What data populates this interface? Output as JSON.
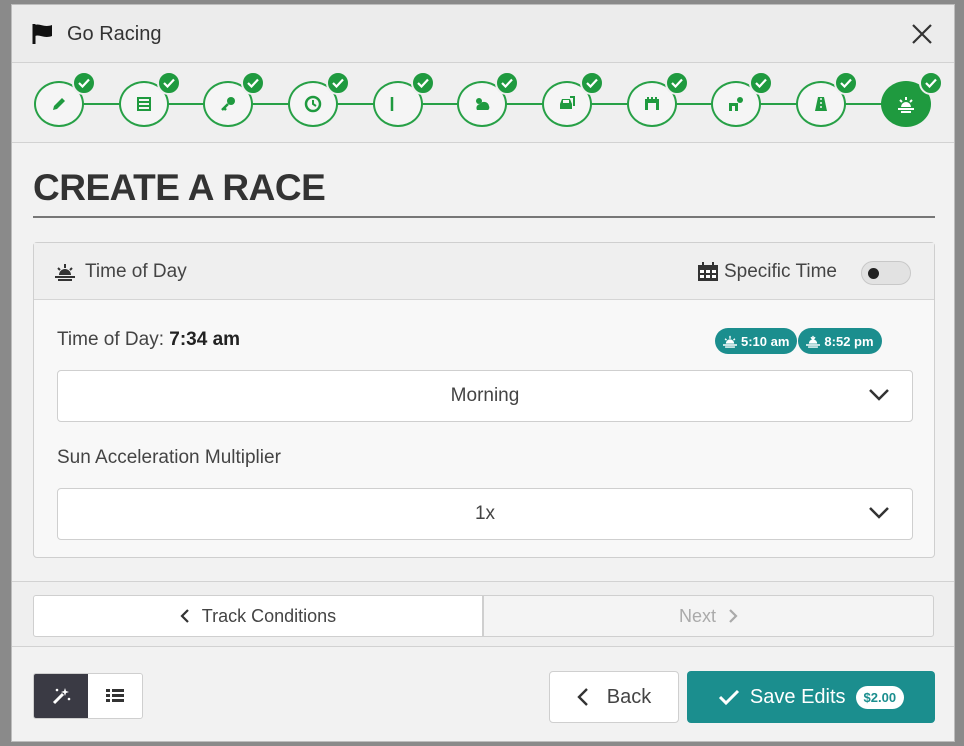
{
  "window": {
    "title": "Go Racing",
    "icons": {
      "flag": "flag-icon",
      "close": "close-icon"
    }
  },
  "stepper": {
    "steps": [
      {
        "icon": "pencil-icon",
        "completed": true
      },
      {
        "icon": "list-icon",
        "completed": true
      },
      {
        "icon": "key-icon",
        "completed": true
      },
      {
        "icon": "clock-icon",
        "completed": true
      },
      {
        "icon": "flag-icon",
        "completed": true
      },
      {
        "icon": "weather-icon",
        "completed": true
      },
      {
        "icon": "car-icon",
        "completed": true
      },
      {
        "icon": "garage-icon",
        "completed": true
      },
      {
        "icon": "pit-icon",
        "completed": true
      },
      {
        "icon": "track-icon",
        "completed": true
      },
      {
        "icon": "sunrise-icon",
        "completed": true,
        "active": true
      }
    ]
  },
  "page": {
    "heading": "CREATE A RACE"
  },
  "panel": {
    "title": "Time of Day",
    "specific_time_label": "Specific Time",
    "specific_time_on": false,
    "time_of_day_label": "Time of Day: ",
    "time_of_day_value": "7:34 am",
    "sunrise": "5:10 am",
    "sunset": "8:52 pm",
    "time_select": "Morning",
    "sun_accel_label": "Sun Acceleration Multiplier",
    "sun_accel_select": "1x"
  },
  "nav": {
    "prev": "Track Conditions",
    "next": "Next"
  },
  "footer": {
    "back": "Back",
    "save": "Save Edits",
    "price": "$2.00"
  },
  "colors": {
    "green": "#1f9a3f",
    "teal": "#1b8e8e"
  }
}
